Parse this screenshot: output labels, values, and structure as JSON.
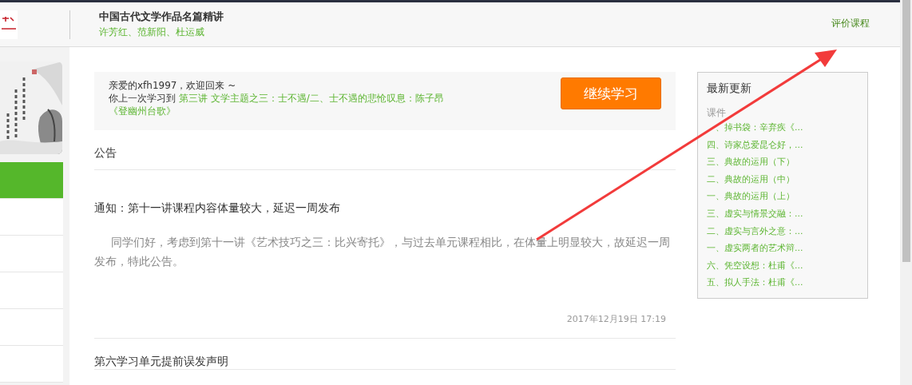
{
  "header": {
    "course_title": "中国古代文学作品名篇精讲",
    "teachers": "许芳红、范新阳、杜运威",
    "evaluate_link": "评价课程"
  },
  "sidebar": {
    "nav_items": [
      {
        "selected": true
      },
      {
        "selected": false
      },
      {
        "selected": false
      },
      {
        "selected": false
      },
      {
        "selected": false
      },
      {
        "selected": false
      }
    ]
  },
  "welcome": {
    "greeting": "亲爱的xfh1997，欢迎回来 ~",
    "last_prefix": "你上一次学习到",
    "last_lesson": "第三讲 文学主题之三：士不遇/二、士不遇的悲怆叹息：陈子昂",
    "last_lesson_cont": "《登幽州台歌》",
    "continue_button": "继续学习"
  },
  "announcements": {
    "heading": "公告",
    "items": [
      {
        "title": "通知：第十一讲课程内容体量较大，延迟一周发布",
        "body": "同学们好，考虑到第十一讲《艺术技巧之三：比兴寄托》，与过去单元课程相比，在体量上明显较大，故延迟一周发布，特此公告。",
        "time": "2017年12月19日 17:19"
      },
      {
        "title": "第六学习单元提前误发声明"
      }
    ]
  },
  "updates": {
    "heading": "最新更新",
    "category": "课件",
    "items": [
      "、掉书袋：辛弃疾《...",
      "四、诗家总爱昆仑好，...",
      "三、典故的运用（下）",
      "二、典故的运用（中）",
      "一、典故的运用（上）",
      "三、虚实与情景交融：...",
      "二、虚实与言外之意：...",
      "一、虚实两者的艺术辩...",
      "六、凭空设想：杜甫《...",
      "五、拟人手法：杜甫《..."
    ]
  }
}
